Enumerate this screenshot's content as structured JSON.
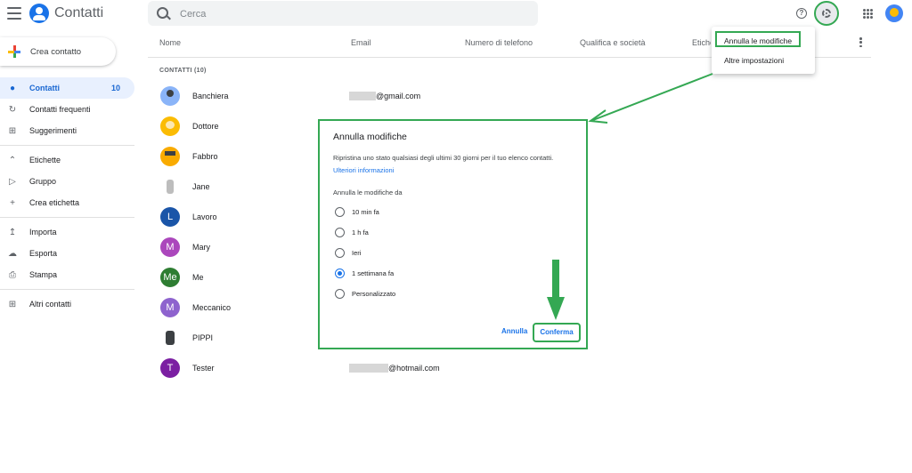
{
  "header": {
    "app_title": "Contatti",
    "search_placeholder": "Cerca",
    "help_glyph": "?"
  },
  "sidebar": {
    "create_label": "Crea contatto",
    "items": [
      {
        "label": "Contatti",
        "count": "10",
        "active": true
      },
      {
        "label": "Contatti frequenti"
      },
      {
        "label": "Suggerimenti"
      },
      {
        "label": "Etichette"
      },
      {
        "label": "Gruppo"
      },
      {
        "label": "Crea etichetta"
      },
      {
        "label": "Importa"
      },
      {
        "label": "Esporta"
      },
      {
        "label": "Stampa"
      },
      {
        "label": "Altri contatti"
      }
    ]
  },
  "table": {
    "columns": [
      "Nome",
      "Email",
      "Numero di telefono",
      "Qualifica e società",
      "Etichette"
    ],
    "section_label": "CONTATTI (10)",
    "rows": [
      {
        "name": "Banchiera",
        "email": "@gmail.com",
        "avatar_letter": "",
        "avatar_color": "#8ab4f8"
      },
      {
        "name": "Dottore",
        "email": "",
        "avatar_letter": "",
        "avatar_color": "#fbbc04"
      },
      {
        "name": "Fabbro",
        "email": "",
        "avatar_letter": "",
        "avatar_color": "#f9ab00"
      },
      {
        "name": "Jane",
        "email": "",
        "avatar_letter": "",
        "avatar_color": "#ffffff"
      },
      {
        "name": "Lavoro",
        "email": "",
        "avatar_letter": "L",
        "avatar_color": "#1a55a8"
      },
      {
        "name": "Mary",
        "email": "",
        "avatar_letter": "M",
        "avatar_color": "#ab47bc"
      },
      {
        "name": "Me",
        "email": "",
        "avatar_letter": "Me",
        "avatar_color": "#2e7d32"
      },
      {
        "name": "Meccanico",
        "email": "",
        "avatar_letter": "M",
        "avatar_color": "#8e63ce"
      },
      {
        "name": "PIPPI",
        "email": "",
        "avatar_letter": "",
        "avatar_color": "#ffffff"
      },
      {
        "name": "Tester",
        "email": "@hotmail.com",
        "avatar_letter": "T",
        "avatar_color": "#7b1fa2"
      }
    ]
  },
  "menu": {
    "items": [
      "Annulla le modifiche",
      "Altre impostazioni"
    ]
  },
  "dialog": {
    "title": "Annulla modifiche",
    "description": "Ripristina uno stato qualsiasi degli ultimi 30 giorni per il tuo elenco contatti.",
    "link": "Ulteriori informazioni",
    "subtitle": "Annulla le modifiche da",
    "options": [
      {
        "label": "10 min fa",
        "checked": false
      },
      {
        "label": "1 h fa",
        "checked": false
      },
      {
        "label": "Ieri",
        "checked": false
      },
      {
        "label": "1 settimana fa",
        "checked": true
      },
      {
        "label": "Personalizzato",
        "checked": false
      }
    ],
    "cancel_label": "Annulla",
    "confirm_label": "Conferma"
  },
  "colors": {
    "accent": "#1a73e8",
    "highlight": "#34a853",
    "active_bg": "#e8f0fe"
  }
}
